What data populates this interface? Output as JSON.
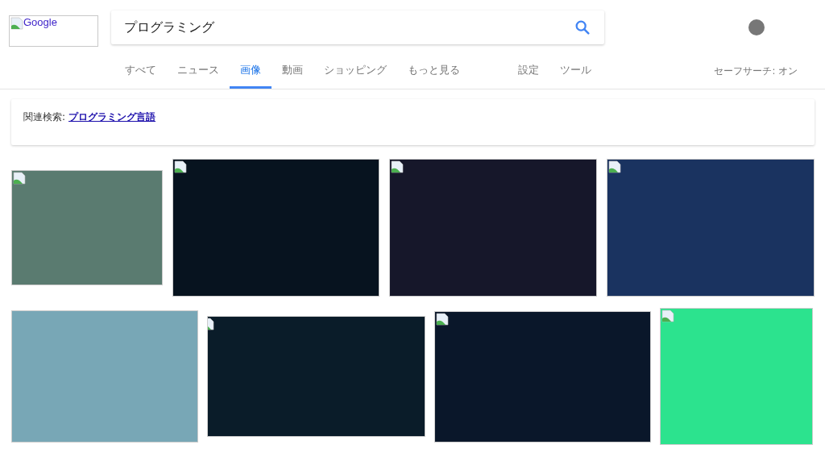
{
  "logo": {
    "alt": "Google"
  },
  "search": {
    "value": "プログラミング"
  },
  "tabs": [
    {
      "label": "すべて",
      "selected": false
    },
    {
      "label": "ニュース",
      "selected": false
    },
    {
      "label": "画像",
      "selected": true
    },
    {
      "label": "動画",
      "selected": false
    },
    {
      "label": "ショッピング",
      "selected": false
    },
    {
      "label": "もっと見る",
      "selected": false
    }
  ],
  "tools": [
    "設定",
    "ツール"
  ],
  "safesearch": "セーフサーチ: オン",
  "related": {
    "label": "関連検索:",
    "link": "プログラミング言語"
  },
  "images": [
    {
      "color": "#5a7b70",
      "broken_icon": true
    },
    {
      "color": "#07131f",
      "broken_icon": true
    },
    {
      "color": "#16172a",
      "broken_icon": true
    },
    {
      "color": "#1a3360",
      "broken_icon": true
    },
    {
      "color": "#78a7b6",
      "broken_icon": false
    },
    {
      "color": "#0a1c29",
      "broken_icon": true
    },
    {
      "color": "#0a172a",
      "broken_icon": true
    },
    {
      "color": "#2ce38e",
      "broken_icon": true
    }
  ]
}
